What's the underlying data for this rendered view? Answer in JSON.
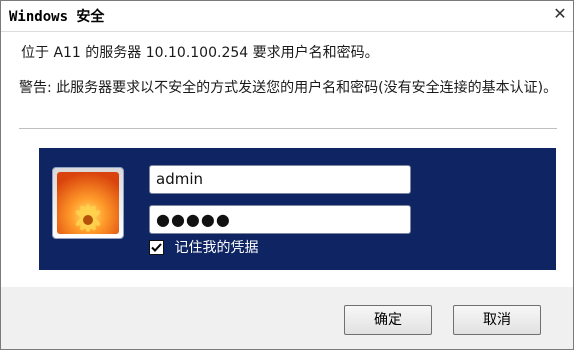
{
  "window": {
    "title": "Windows 安全",
    "close_glyph": "✕"
  },
  "message": {
    "server_line": "位于 A11 的服务器 10.10.100.254 要求用户名和密码。",
    "warning": "警告: 此服务器要求以不安全的方式发送您的用户名和密码(没有安全连接的基本认证)。"
  },
  "credentials": {
    "username_value": "admin",
    "password_masked": "●●●●●",
    "remember_label": "记住我的凭据",
    "remember_checked": true,
    "avatar_icon": "user-avatar-flower"
  },
  "buttons": {
    "ok_label": "确定",
    "cancel_label": "取消"
  },
  "colors": {
    "panel_bg": "#0f2563",
    "window_bg": "#f0f0f0",
    "content_bg": "#ffffff"
  }
}
